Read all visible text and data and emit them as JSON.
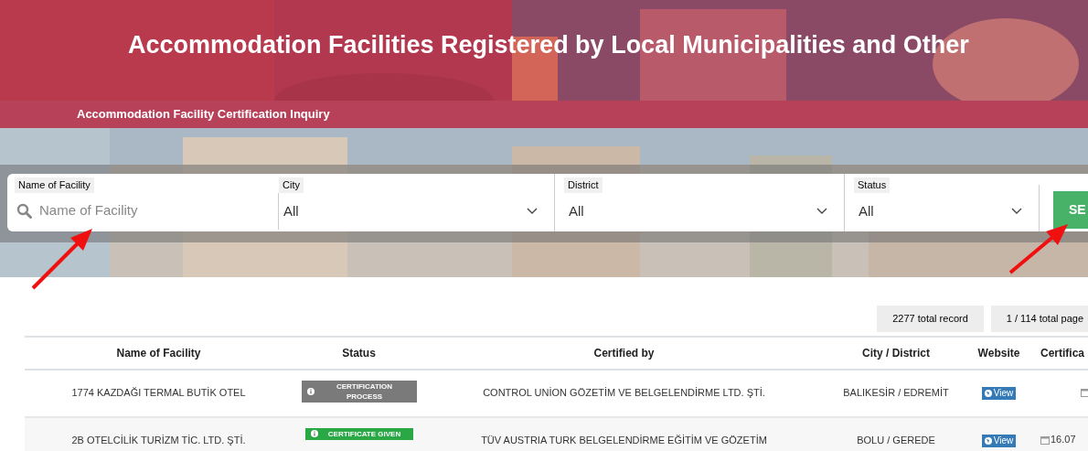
{
  "header": {
    "title": "Accommodation Facilities Registered by Local Municipalities and Other"
  },
  "nav": {
    "title": "Accommodation Facility Certification Inquiry"
  },
  "search": {
    "fields": [
      {
        "kind": "text",
        "label": "Name of Facility",
        "placeholder": "Name of Facility"
      },
      {
        "kind": "select",
        "label": "City",
        "value": "All"
      },
      {
        "kind": "select",
        "label": "District",
        "value": "All"
      },
      {
        "kind": "select",
        "label": "Status",
        "value": "All"
      }
    ],
    "button": "SE"
  },
  "summary": {
    "total_records": "2277 total record",
    "total_pages": "1 / 114 total page"
  },
  "table": {
    "columns": [
      "Name of Facility",
      "Status",
      "Certified by",
      "City / District",
      "Website",
      "Certifica"
    ],
    "rows": [
      {
        "name": "1774 KAZDAĞI TERMAL BUTİK OTEL",
        "status": {
          "kind": "process",
          "label": "CERTIFICATION PROCESS"
        },
        "certified_by": "CONTROL UNİON GÖZETİM VE BELGELENDİRME LTD. ŞTİ.",
        "city_district": "BALIKESİR / EDREMİT",
        "website": "View"
      },
      {
        "name": "2B OTELCİLİK TURİZM TİC. LTD. ŞTİ.",
        "status": {
          "kind": "given",
          "label": "CERTIFICATE GIVEN"
        },
        "certified_by": "TÜV AUSTRIA TURK BELGELENDİRME EĞİTİM VE GÖZETİM",
        "city_district": "BOLU / GEREDE",
        "website": "View",
        "certificate_date": "16.07"
      }
    ]
  }
}
